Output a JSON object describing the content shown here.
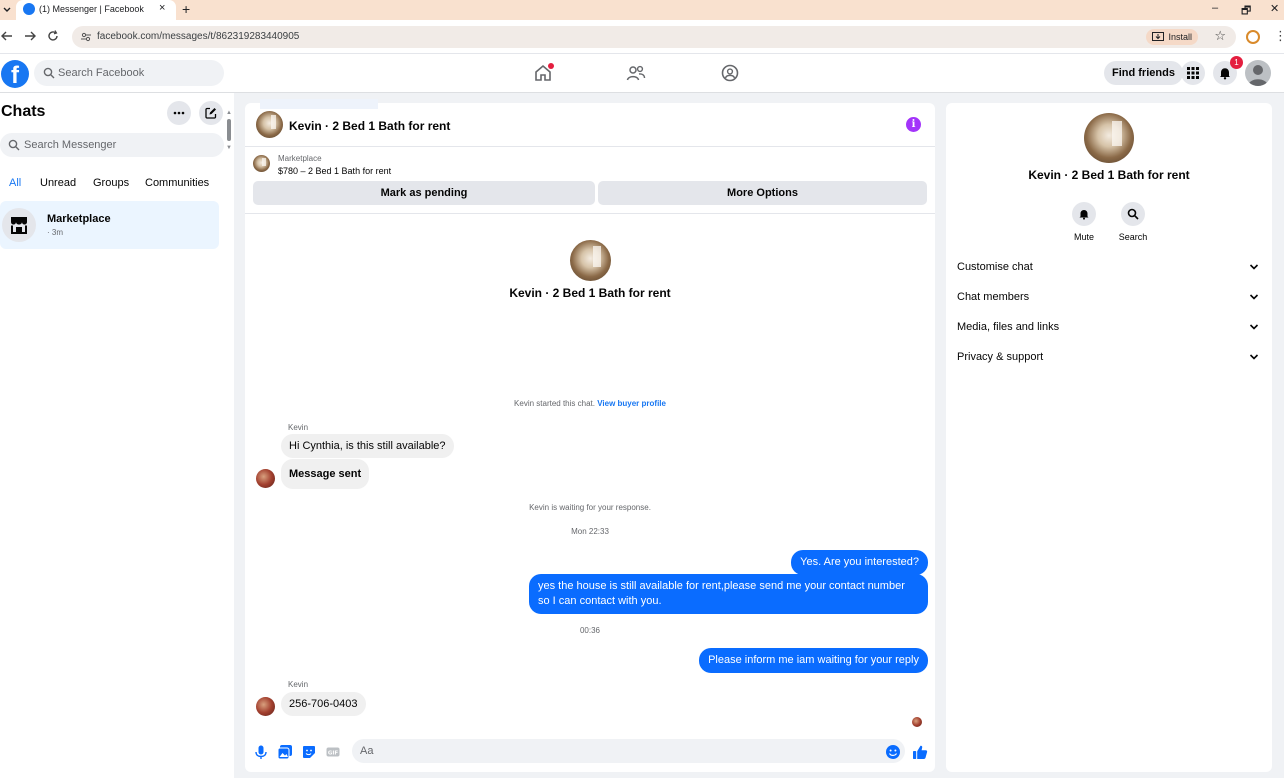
{
  "browser": {
    "tab_title": "(1) Messenger | Facebook",
    "tab_close": "×",
    "new_tab": "+",
    "url": "facebook.com/messages/t/862319283440905",
    "install_label": "Install",
    "window_min": "–",
    "window_restore": "🗗",
    "window_close": "✕"
  },
  "fbnav": {
    "search_placeholder": "Search Facebook",
    "find_friends": "Find friends",
    "notification_count": "1",
    "logo_letter": "f"
  },
  "sidebar": {
    "title": "Chats",
    "search_placeholder": "Search Messenger",
    "filters": [
      "All",
      "Unread",
      "Groups",
      "Communities"
    ],
    "chats": [
      {
        "name": "Marketplace",
        "meta": "· 3m"
      }
    ]
  },
  "conversation": {
    "header_title": "Kevin · 2 Bed 1 Bath for rent",
    "info_glyph": "i",
    "marketplace_label": "Marketplace",
    "listing": "$780 – 2 Bed 1 Bath for rent",
    "mark_pending": "Mark as pending",
    "more_options": "More Options",
    "profile_name": "Kevin · 2 Bed 1 Bath for rent",
    "started_text": "Kevin started this chat.",
    "view_buyer": "View buyer profile",
    "messages": [
      {
        "sender": "Kevin",
        "text": "Hi Cynthia, is this still available?"
      },
      {
        "text": "Message sent"
      },
      {
        "system": "Kevin is waiting for your response."
      },
      {
        "timestamp": "Mon 22:33"
      },
      {
        "text": "Yes. Are you interested?"
      },
      {
        "text": "yes the house is still available for rent,please send me your contact number so I can contact with you."
      },
      {
        "timestamp": "00:36"
      },
      {
        "text": "Please inform me iam waiting for your reply"
      },
      {
        "sender": "Kevin",
        "text": "256-706-0403"
      }
    ],
    "composer_placeholder": "Aa"
  },
  "details": {
    "name": "Kevin · 2 Bed 1 Bath for rent",
    "actions": [
      "Mute",
      "Search"
    ],
    "sections": [
      "Customise chat",
      "Chat members",
      "Media, files and links",
      "Privacy & support"
    ]
  },
  "colors": {
    "brand": "#1877f2",
    "outgoing_bubble": "#0a6cff",
    "incoming_bubble": "#f0f0f0",
    "info_purple": "#a334fa",
    "badge_red": "#e41e3f"
  }
}
